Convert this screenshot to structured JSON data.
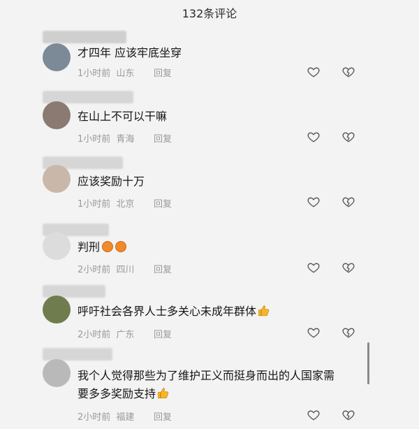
{
  "header": {
    "title": "132条评论"
  },
  "comments": [
    {
      "text": "才四年 应该牢底坐穿",
      "time": "1小时前",
      "location": "山东",
      "reply": "回复",
      "emoji": ""
    },
    {
      "text": "在山上不可以干嘛",
      "time": "1小时前",
      "location": "青海",
      "reply": "回复",
      "emoji": ""
    },
    {
      "text": "应该奖励十万",
      "time": "1小时前",
      "location": "北京",
      "reply": "回复",
      "emoji": ""
    },
    {
      "text": "判刑",
      "time": "2小时前",
      "location": "四川",
      "reply": "回复",
      "emoji": "angry-x2"
    },
    {
      "text": "呼吁社会各界人士多关心未成年群体",
      "time": "2小时前",
      "location": "广东",
      "reply": "回复",
      "emoji": "thumbs-up"
    },
    {
      "text": "我个人觉得那些为了维护正义而挺身而出的人国家需",
      "text2": "要多多奖励支持",
      "time": "2小时前",
      "location": "福建",
      "reply": "回复",
      "emoji": "thumbs-up"
    }
  ],
  "colors": {
    "background": "#f3f3f3",
    "meta_text": "#9a9a9a",
    "icon": "#555555"
  }
}
